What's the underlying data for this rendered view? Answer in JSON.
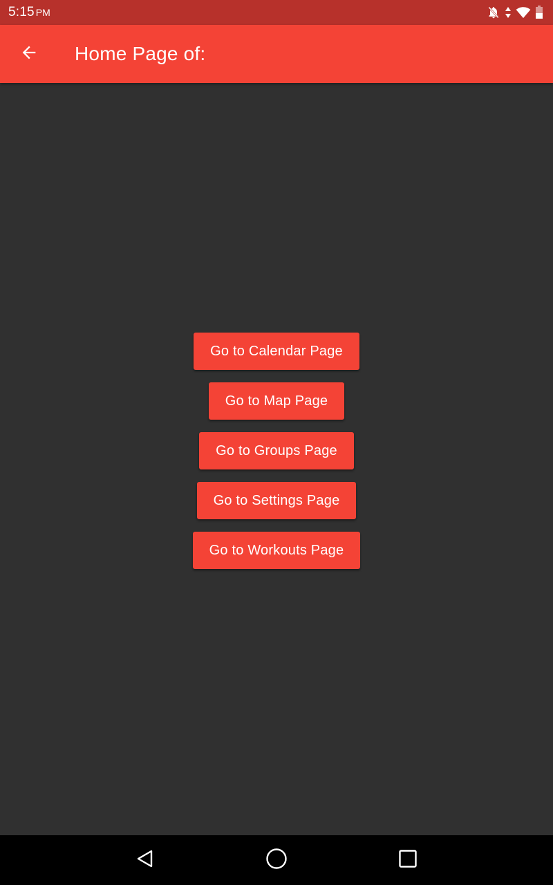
{
  "status_bar": {
    "time": "5:15",
    "ampm": "PM",
    "icons": [
      "notifications-off-icon",
      "data-arrows-icon",
      "wifi-icon",
      "battery-icon"
    ]
  },
  "app_bar": {
    "back_icon": "arrow-back-icon",
    "title": "Home Page of:"
  },
  "buttons": {
    "calendar": "Go to Calendar Page",
    "map": "Go to Map Page",
    "groups": "Go to Groups Page",
    "settings": "Go to Settings Page",
    "workouts": "Go to Workouts Page"
  },
  "nav_bar": {
    "icons": [
      "back-triangle-icon",
      "home-circle-icon",
      "recents-square-icon"
    ]
  },
  "colors": {
    "status_bar": "#B7312B",
    "app_bar": "#F44336",
    "background": "#303030",
    "button": "#F44336",
    "nav_bar": "#000000"
  }
}
